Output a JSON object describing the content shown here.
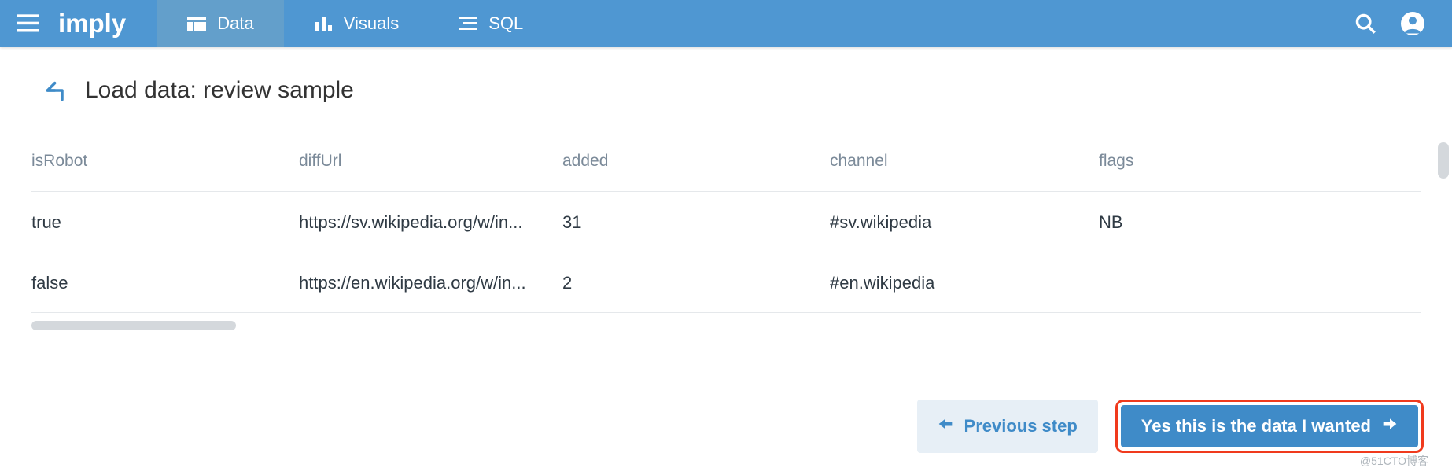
{
  "brand": "imply",
  "nav": {
    "tabs": [
      {
        "label": "Data",
        "active": true
      },
      {
        "label": "Visuals",
        "active": false
      },
      {
        "label": "SQL",
        "active": false
      }
    ]
  },
  "page": {
    "title": "Load data: review sample"
  },
  "table": {
    "columns": [
      "isRobot",
      "diffUrl",
      "added",
      "channel",
      "flags"
    ],
    "rows": [
      {
        "isRobot": "true",
        "diffUrl": "https://sv.wikipedia.org/w/in...",
        "added": "31",
        "channel": "#sv.wikipedia",
        "flags": "NB"
      },
      {
        "isRobot": "false",
        "diffUrl": "https://en.wikipedia.org/w/in...",
        "added": "2",
        "channel": "#en.wikipedia",
        "flags": ""
      }
    ]
  },
  "footer": {
    "prev_label": "Previous step",
    "confirm_label": "Yes this is the data I wanted"
  },
  "watermark": "@51CTO博客"
}
